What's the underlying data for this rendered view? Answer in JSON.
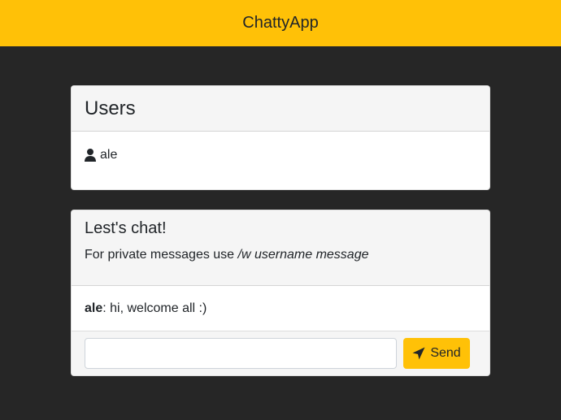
{
  "navbar": {
    "brand": "ChattyApp"
  },
  "users": {
    "title": "Users",
    "list": [
      {
        "name": "ale",
        "icon": "user-icon"
      }
    ]
  },
  "chat": {
    "title": "Lest's chat!",
    "subtitle_prefix": "For private messages use ",
    "subtitle_command": "/w username message",
    "messages": [
      {
        "user": "ale",
        "text": ": hi, welcome all :)"
      }
    ],
    "input": {
      "value": "",
      "placeholder": ""
    },
    "send_label": "Send",
    "send_icon": "paper-plane-icon"
  },
  "colors": {
    "accent": "#ffc107",
    "background": "#262626",
    "card_header": "#f5f5f5"
  }
}
